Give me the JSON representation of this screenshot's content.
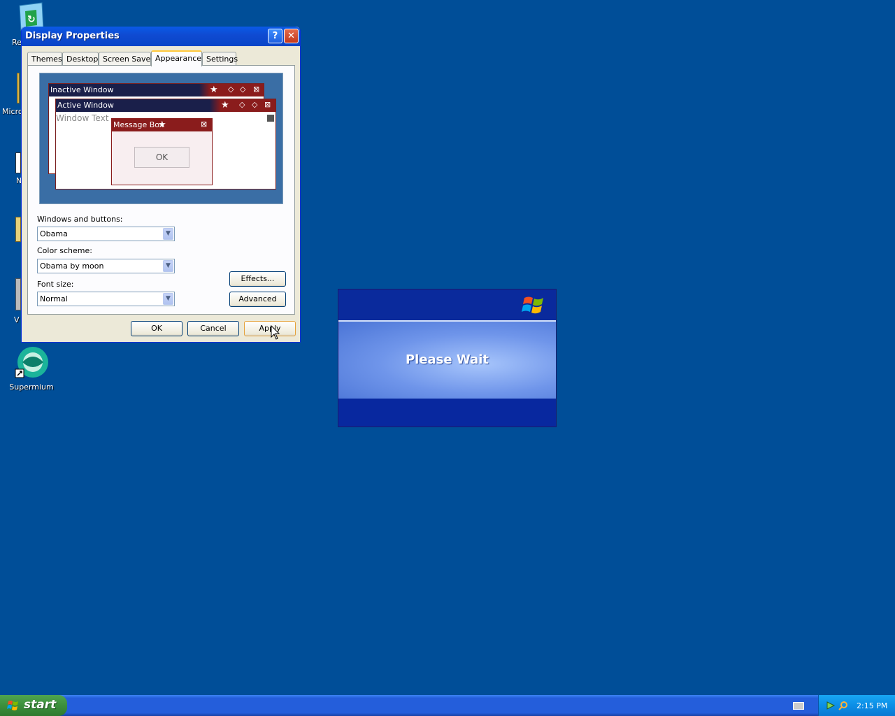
{
  "desktop": {
    "icons": {
      "recycle_partial": "Re",
      "micro_partial": "Micro",
      "n_partial": "N",
      "v_partial": "V",
      "supermium": "Supermium"
    }
  },
  "window": {
    "title": "Display Properties",
    "help_glyph": "?",
    "close_glyph": "✕",
    "tabs": [
      {
        "label": "Themes"
      },
      {
        "label": "Desktop"
      },
      {
        "label": "Screen Saver"
      },
      {
        "label": "Appearance"
      },
      {
        "label": "Settings"
      }
    ],
    "active_tab": "Appearance",
    "preview": {
      "inactive_title": "Inactive Window",
      "active_title": "Active Window",
      "window_text": "Window Text",
      "message_box_title": "Message Box",
      "ok_label": "OK"
    },
    "fields": {
      "windows_buttons_label": "Windows and buttons:",
      "windows_buttons_value": "Obama",
      "color_scheme_label": "Color scheme:",
      "color_scheme_value": "Obama by moon",
      "font_size_label": "Font size:",
      "font_size_value": "Normal"
    },
    "buttons": {
      "effects": "Effects...",
      "advanced": "Advanced",
      "ok": "OK",
      "cancel": "Cancel",
      "apply": "Apply"
    }
  },
  "wait_dialog": {
    "message": "Please Wait"
  },
  "taskbar": {
    "start_label": "start",
    "clock": "2:15 PM"
  },
  "colors": {
    "desktop": "#004e98",
    "titlebar": "#0a5ae6",
    "preview_accent": "#8a1c1c"
  }
}
